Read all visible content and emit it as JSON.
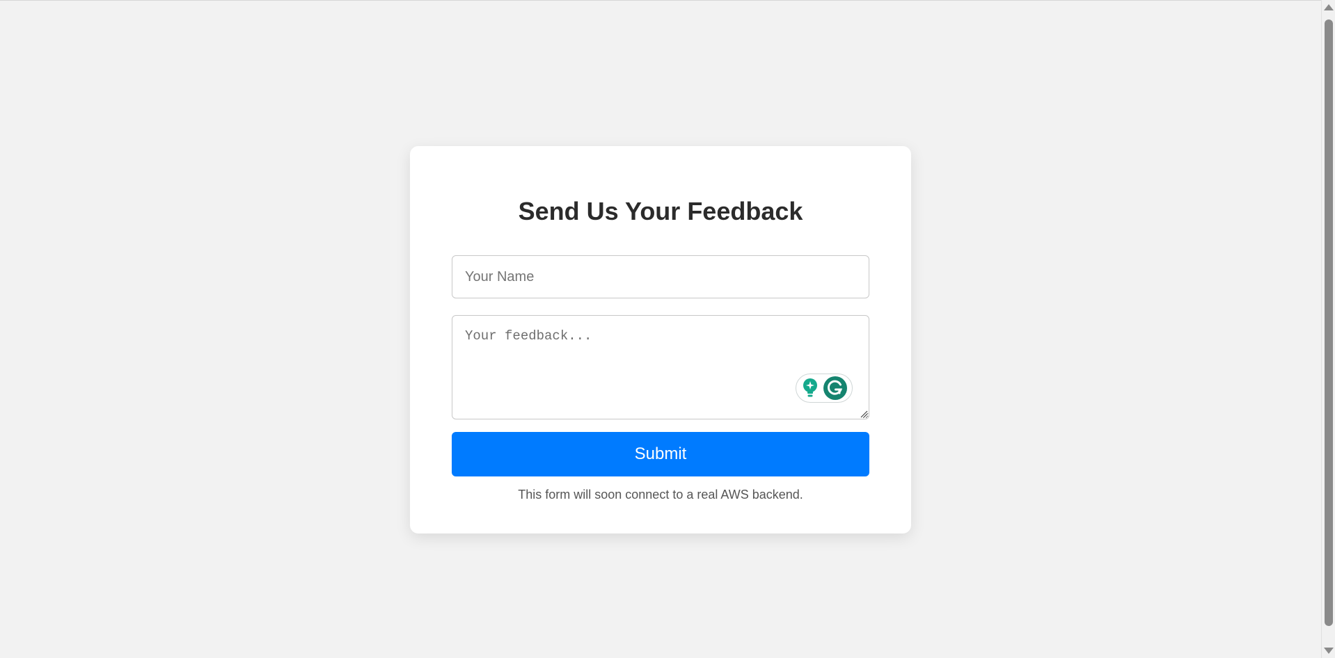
{
  "form": {
    "title": "Send Us Your Feedback",
    "name_placeholder": "Your Name",
    "name_value": "",
    "feedback_placeholder": "Your feedback...",
    "feedback_value": "",
    "submit_label": "Submit",
    "note": "This form will soon connect to a real AWS backend."
  },
  "grammarly_widget": {
    "icons": [
      "lightbulb-icon",
      "grammarly-g-icon"
    ]
  },
  "colors": {
    "background": "#f2f2f2",
    "card": "#ffffff",
    "accent": "#007bff",
    "grammarly_green": "#15846f"
  }
}
